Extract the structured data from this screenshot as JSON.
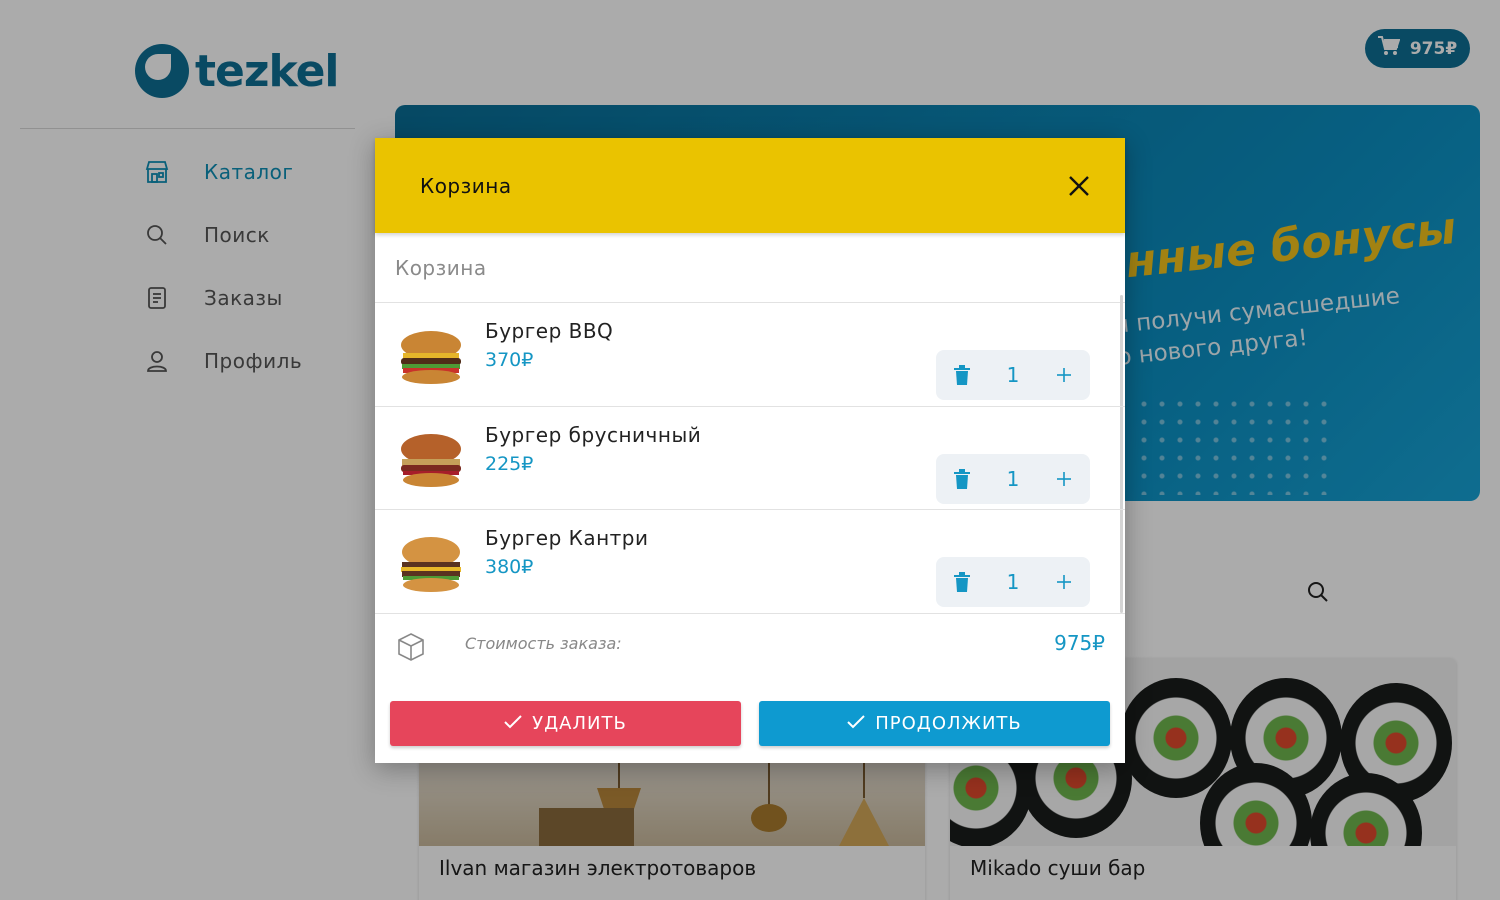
{
  "app": {
    "name": "tezkel"
  },
  "header": {
    "cart_total": "975₽"
  },
  "sidebar": {
    "items": [
      {
        "label": "Каталог",
        "icon": "store-icon",
        "active": true
      },
      {
        "label": "Поиск",
        "icon": "search-icon",
        "active": false
      },
      {
        "label": "Заказы",
        "icon": "orders-icon",
        "active": false
      },
      {
        "label": "Профиль",
        "icon": "profile-icon",
        "active": false
      }
    ]
  },
  "banner": {
    "title": "нные бонусы",
    "subtitle_line1": "и получи сумасшедшие",
    "subtitle_line2": "о нового друга!"
  },
  "shops": [
    {
      "name": "Ilvan магазин электротоваров"
    },
    {
      "name": "Mikado суши бар"
    }
  ],
  "modal": {
    "title": "Корзина",
    "section_title": "Корзина",
    "items": [
      {
        "name": "Бургер BBQ",
        "price": "370₽",
        "qty": "1"
      },
      {
        "name": "Бургер брусничный",
        "price": "225₽",
        "qty": "1"
      },
      {
        "name": "Бургер Кантри",
        "price": "380₽",
        "qty": "1"
      }
    ],
    "total_label": "Стоимость заказа:",
    "total_value": "975₽",
    "delete_label": "УДАЛИТЬ",
    "continue_label": "ПРОДОЛЖИТЬ"
  },
  "colors": {
    "primary": "#0e6f94",
    "accent": "#1596c4",
    "header_yellow": "#eac300",
    "danger": "#e6455b",
    "continue": "#0e9ad0"
  }
}
